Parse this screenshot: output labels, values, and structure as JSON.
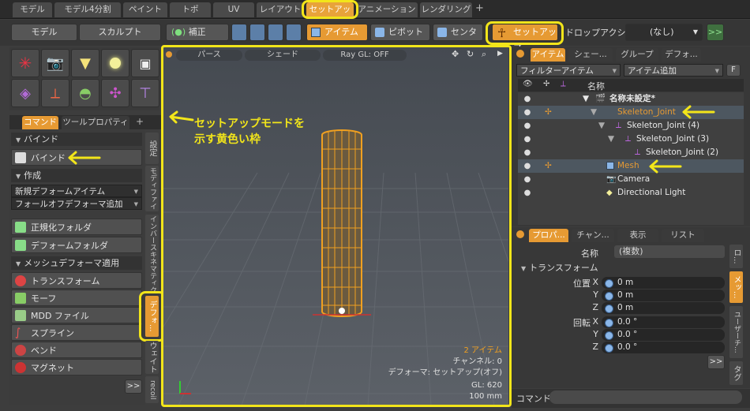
{
  "layout_tabs": [
    "モデル",
    "モデル4分割",
    "ペイント",
    "トポ",
    "UV",
    "レイアウト",
    "セットアップ",
    "アニメーション",
    "レンダリング"
  ],
  "layout_tabs_active": "セットアップ",
  "plus": "+",
  "left_mode": {
    "model": "モデル",
    "sculpt": "スカルプト"
  },
  "toolbar": {
    "snap": "補正",
    "item": "アイテム",
    "pivot": "ピボット",
    "center": "センター",
    "setup": "セットアップ",
    "drop_action": "ドロップアクション",
    "drop_value": "(なし)",
    "expand": ">>"
  },
  "left_tabs": {
    "command": "コマンド",
    "tool_props": "ツールプロパティ"
  },
  "sections": {
    "bind": "バインド",
    "create": "作成",
    "mesh_deformer": "メッシュデフォーマ適用"
  },
  "bind_button": "バインド",
  "create_dropdowns": [
    "新規デフォームアイテム",
    "フォールオフデフォーマ追加"
  ],
  "folder_buttons": [
    "正規化フォルダ",
    "デフォームフォルダ"
  ],
  "deformer_buttons": [
    "トランスフォーム",
    "モーフ",
    "MDD ファイル",
    "スプライン",
    "ベンド",
    "マグネット"
  ],
  "vertical_tabs": [
    "設定",
    "モディファイア...",
    "インバースキネマティクス",
    "デフォ...",
    "ウェイト",
    "recoil"
  ],
  "left_more": ">>",
  "viewport": {
    "buttons": [
      "パース",
      "シェード",
      "Ray GL: OFF"
    ],
    "info": [
      "2 アイテム",
      "チャンネル: 0",
      "デフォーマ: セットアップ(オフ)",
      "GL: 620",
      "100 mm"
    ]
  },
  "annotations": {
    "yellow_frame_line1": "セットアップモードを",
    "yellow_frame_line2": "示す黄色い枠"
  },
  "item_panel": {
    "tabs": [
      "アイテム",
      "シェー...",
      "グループ",
      "デフォ..."
    ],
    "filter": "フィルターアイテム",
    "add": "アイテム追加",
    "f": "F",
    "header_name": "名称",
    "rows": [
      {
        "name": "名称未設定*",
        "indent": 0
      },
      {
        "name": "Skeleton_Joint",
        "indent": 1
      },
      {
        "name": "Skeleton_Joint (4)",
        "indent": 2
      },
      {
        "name": "Skeleton_Joint (3)",
        "indent": 3
      },
      {
        "name": "Skeleton_Joint (2)",
        "indent": 4
      },
      {
        "name": "Mesh",
        "indent": 1
      },
      {
        "name": "Camera",
        "indent": 1
      },
      {
        "name": "Directional Light",
        "indent": 1
      }
    ]
  },
  "props_panel": {
    "tabs": [
      "プロパ...",
      "チャン...",
      "表示",
      "リスト"
    ],
    "name_label": "名称",
    "name_value": "(複数)",
    "transform": "トランスフォーム",
    "position_label": "位置",
    "rotation_label": "回転",
    "axes": [
      "X",
      "Y",
      "Z"
    ],
    "position_values": [
      "0 m",
      "0 m",
      "0 m"
    ],
    "rotation_values": [
      "0.0 °",
      "0.0 °",
      "0.0 °"
    ],
    "side_tabs": [
      "ロ...",
      "メッ...",
      "ユーザーチ...",
      "タグ"
    ],
    "more": ">>"
  },
  "command_label": "コマンド",
  "colors": {
    "accent": "#e69a33",
    "highlight": "#f2e51a",
    "selected_row": "#4d5760"
  }
}
